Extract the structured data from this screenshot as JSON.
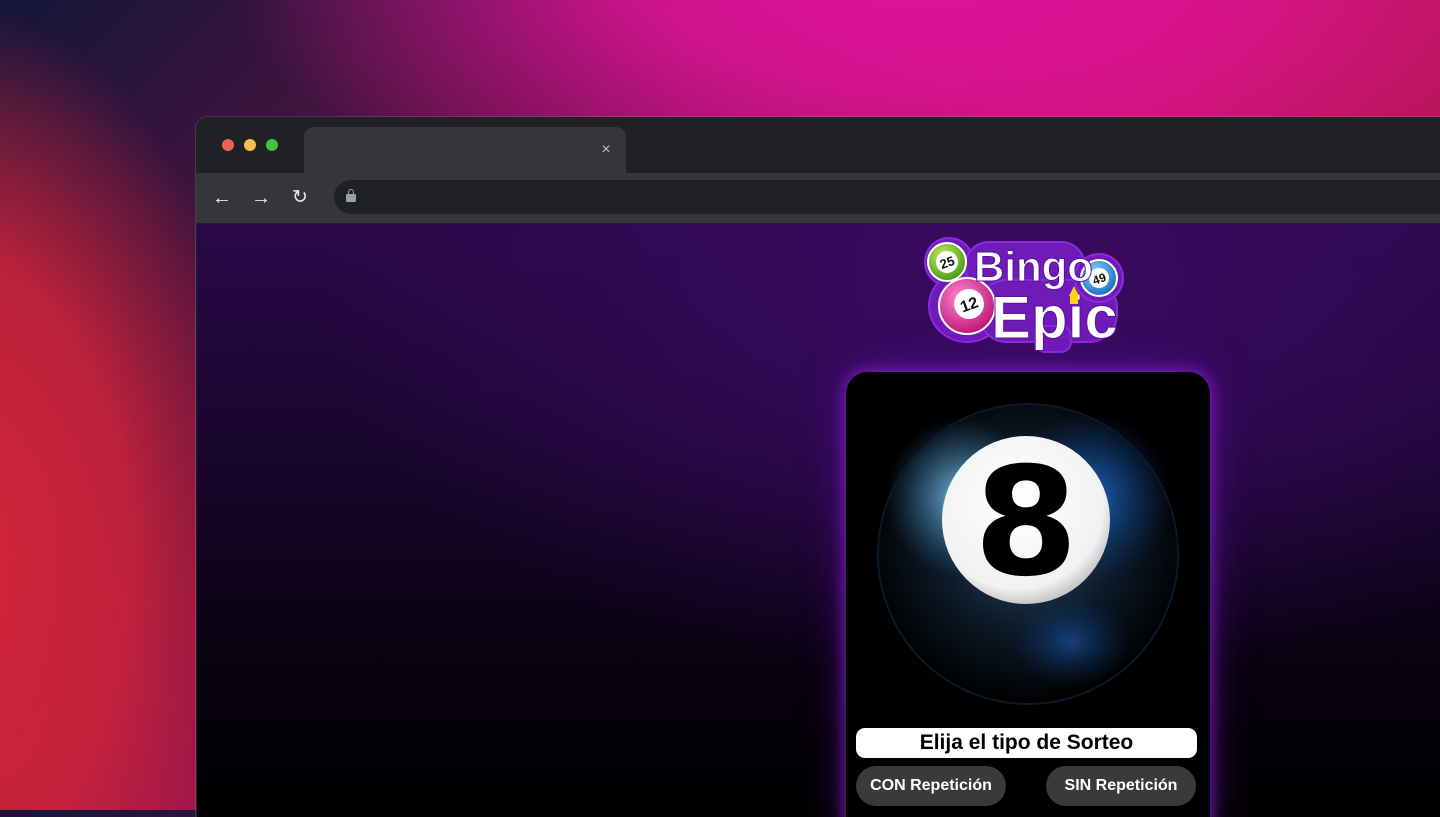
{
  "browser": {
    "tab": {
      "title": "",
      "close_glyph": "×"
    },
    "nav": {
      "back_glyph": "←",
      "forward_glyph": "→",
      "reload_glyph": "↻"
    },
    "address_bar": {
      "url": ""
    }
  },
  "page": {
    "logo": {
      "word1": "Bingo",
      "word2": "Epic",
      "balls": [
        "25",
        "12",
        "49"
      ]
    },
    "ball_number": "8",
    "prompt": "Elija el tipo de Sorteo",
    "buttons": {
      "con_label": "CON Repetición",
      "sin_label": "SIN Repetición"
    }
  },
  "colors": {
    "accent_purple": "#7a22c8",
    "card_glow": "#aa28ff",
    "button_bg": "#3a3a3c"
  }
}
